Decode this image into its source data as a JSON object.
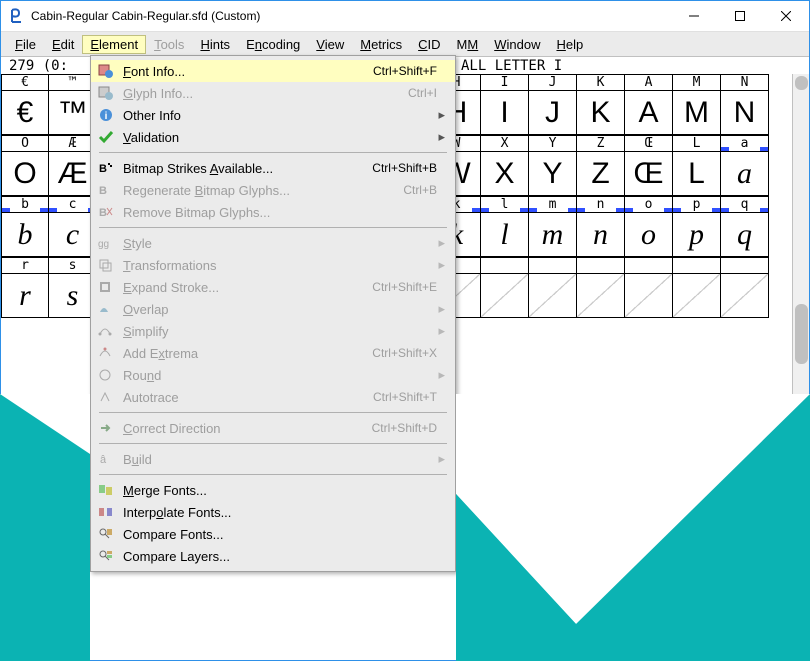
{
  "window": {
    "title": "Cabin-Regular  Cabin-Regular.sfd (Custom)"
  },
  "menubar": [
    {
      "label": "File",
      "ul": 0
    },
    {
      "label": "Edit",
      "ul": 0
    },
    {
      "label": "Element",
      "ul": 0,
      "active": true
    },
    {
      "label": "Tools",
      "ul": 0,
      "disabled": true
    },
    {
      "label": "Hints",
      "ul": 0
    },
    {
      "label": "Encoding",
      "ul": 1
    },
    {
      "label": "View",
      "ul": 0
    },
    {
      "label": "Metrics",
      "ul": 0
    },
    {
      "label": "CID",
      "ul": 0
    },
    {
      "label": "MM",
      "ul": 1
    },
    {
      "label": "Window",
      "ul": 0
    },
    {
      "label": "Help",
      "ul": 0
    }
  ],
  "status": {
    "left": "279 (0:",
    "right": "ALL LETTER I"
  },
  "dropdown": [
    {
      "icon": "font-info-icon",
      "label": "Font Info...",
      "ul": 0,
      "key": "Ctrl+Shift+F",
      "hl": true
    },
    {
      "icon": "glyph-info-icon",
      "label": "Glyph Info...",
      "ul": 0,
      "key": "Ctrl+I",
      "disabled": true
    },
    {
      "icon": "info-icon",
      "label": "Other Info",
      "sub": true
    },
    {
      "icon": "check-icon",
      "label": "Validation",
      "ul": 0,
      "sub": true
    },
    {
      "sep": true
    },
    {
      "icon": "bitmap-icon",
      "label": "Bitmap Strikes Available...",
      "ul": 15,
      "key": "Ctrl+Shift+B"
    },
    {
      "icon": "regen-icon",
      "label": "Regenerate Bitmap Glyphs...",
      "ul": 11,
      "key": "Ctrl+B",
      "disabled": true
    },
    {
      "icon": "remove-icon",
      "label": "Remove Bitmap Glyphs...",
      "disabled": true
    },
    {
      "sep": true
    },
    {
      "icon": "style-icon",
      "label": "Style",
      "ul": 0,
      "sub": true,
      "disabled": true
    },
    {
      "icon": "transform-icon",
      "label": "Transformations",
      "ul": 0,
      "sub": true,
      "disabled": true
    },
    {
      "icon": "expand-icon",
      "label": "Expand Stroke...",
      "ul": 0,
      "key": "Ctrl+Shift+E",
      "disabled": true
    },
    {
      "icon": "overlap-icon",
      "label": "Overlap",
      "ul": 0,
      "sub": true,
      "disabled": true
    },
    {
      "icon": "simplify-icon",
      "label": "Simplify",
      "ul": 0,
      "sub": true,
      "disabled": true
    },
    {
      "icon": "extrema-icon",
      "label": "Add Extrema",
      "ul": 5,
      "key": "Ctrl+Shift+X",
      "disabled": true
    },
    {
      "icon": "round-icon",
      "label": "Round",
      "ul": 3,
      "sub": true,
      "disabled": true
    },
    {
      "icon": "autotrace-icon",
      "label": "Autotrace",
      "key": "Ctrl+Shift+T",
      "disabled": true
    },
    {
      "sep": true
    },
    {
      "icon": "correct-icon",
      "label": "Correct Direction",
      "ul": 0,
      "key": "Ctrl+Shift+D",
      "disabled": true
    },
    {
      "sep": true
    },
    {
      "icon": "build-icon",
      "label": "Build",
      "ul": 1,
      "sub": true,
      "disabled": true
    },
    {
      "sep": true
    },
    {
      "icon": "merge-icon",
      "label": "Merge Fonts...",
      "ul": 0
    },
    {
      "icon": "interpolate-icon",
      "label": "Interpolate Fonts...",
      "ul": 6
    },
    {
      "icon": "compare-icon",
      "label": "Compare Fonts..."
    },
    {
      "icon": "compare-layers-icon",
      "label": "Compare Layers..."
    }
  ],
  "grid": {
    "rows": [
      {
        "hdr": [
          "€",
          "™",
          "",
          "",
          "",
          "",
          "",
          "",
          "",
          "H",
          "I",
          "J",
          "K",
          "A",
          "M",
          "N"
        ],
        "gly": [
          "€",
          "™",
          "",
          "",
          "",
          "",
          "",
          "",
          "",
          "H",
          "I",
          "J",
          "K",
          "A",
          "M",
          "N"
        ]
      },
      {
        "hdr": [
          "O",
          "Æ",
          "",
          "",
          "",
          "",
          "",
          "",
          "",
          "W",
          "X",
          "Y",
          "Z",
          "Œ",
          "L",
          "a"
        ],
        "gly": [
          "O",
          "Æ",
          "",
          "",
          "",
          "",
          "",
          "",
          "",
          "W",
          "X",
          "Y",
          "Z",
          "Œ",
          "L",
          "a"
        ],
        "lastItal": true,
        "marks": [
          15
        ]
      },
      {
        "hdr": [
          "b",
          "c",
          "",
          "",
          "",
          "",
          "",
          "",
          "",
          "k",
          "l",
          "m",
          "n",
          "o",
          "p",
          "q"
        ],
        "gly": [
          "b",
          "c",
          "",
          "",
          "",
          "",
          "",
          "",
          "",
          "k",
          "l",
          "m",
          "n",
          "o",
          "p",
          "q"
        ],
        "ital": true,
        "marks": [
          0,
          1,
          9,
          10,
          11,
          12,
          13,
          14,
          15
        ]
      },
      {
        "hdr": [
          "r",
          "s",
          "",
          "",
          "",
          "",
          "",
          "",
          "",
          "",
          "",
          "",
          "",
          "",
          "",
          ""
        ],
        "gly": [
          "r",
          "s",
          "",
          "",
          "",
          "",
          "",
          "",
          "",
          "",
          "",
          "",
          "",
          "",
          "",
          ""
        ],
        "ital": true,
        "empty": true
      }
    ]
  }
}
